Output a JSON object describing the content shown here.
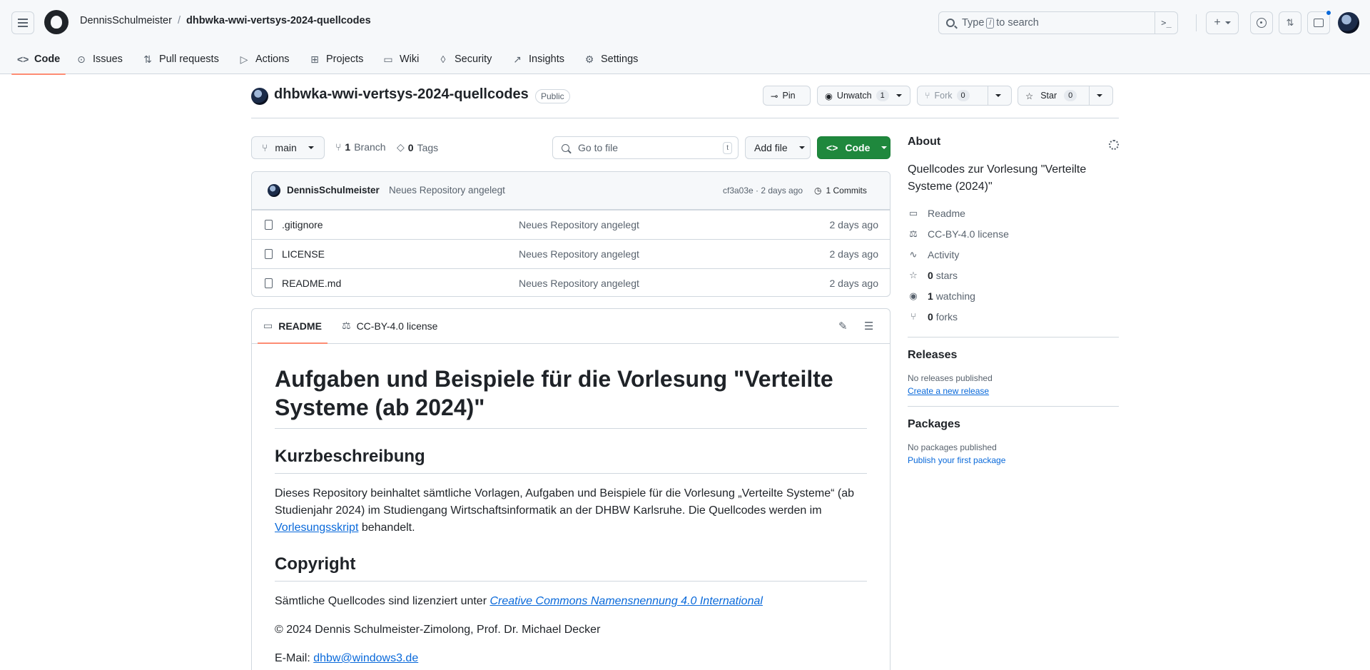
{
  "header": {
    "owner": "DennisSchulmeister",
    "separator": "/",
    "repo": "dhbwka-wwi-vertsys-2024-quellcodes",
    "search_prefix": "Type",
    "search_key": "/",
    "search_suffix": "to search"
  },
  "tabs": [
    {
      "label": "Code",
      "icon": "code-icon"
    },
    {
      "label": "Issues",
      "icon": "issue-icon"
    },
    {
      "label": "Pull requests",
      "icon": "pull-request-icon"
    },
    {
      "label": "Actions",
      "icon": "play-icon"
    },
    {
      "label": "Projects",
      "icon": "table-icon"
    },
    {
      "label": "Wiki",
      "icon": "book-icon"
    },
    {
      "label": "Security",
      "icon": "shield-icon"
    },
    {
      "label": "Insights",
      "icon": "graph-icon"
    },
    {
      "label": "Settings",
      "icon": "gear-icon"
    }
  ],
  "repo": {
    "title": "dhbwka-wwi-vertsys-2024-quellcodes",
    "visibility": "Public",
    "pin_label": "Pin",
    "watch_label": "Unwatch",
    "watch_count": "1",
    "fork_label": "Fork",
    "fork_count": "0",
    "star_label": "Star",
    "star_count": "0"
  },
  "branchbar": {
    "branch": "main",
    "branch_count": "1",
    "branch_label": "Branch",
    "tag_count": "0",
    "tag_label": "Tags",
    "goto_placeholder": "Go to file",
    "goto_key": "t",
    "add_file": "Add file",
    "code": "Code"
  },
  "latest_commit": {
    "author": "DennisSchulmeister",
    "message": "Neues Repository angelegt",
    "hash_time": "cf3a03e · 2 days ago",
    "commits": "1 Commits"
  },
  "files": [
    {
      "name": ".gitignore",
      "message": "Neues Repository angelegt",
      "age": "2 days ago"
    },
    {
      "name": "LICENSE",
      "message": "Neues Repository angelegt",
      "age": "2 days ago"
    },
    {
      "name": "README.md",
      "message": "Neues Repository angelegt",
      "age": "2 days ago"
    }
  ],
  "readme": {
    "tab_readme": "README",
    "tab_license": "CC-BY-4.0 license",
    "h1": "Aufgaben und Beispiele für die Vorlesung \"Verteilte Systeme (ab 2024)\"",
    "h2_desc": "Kurzbeschreibung",
    "desc_text": "Dieses Repository beinhaltet sämtliche Vorlagen, Aufgaben und Beispiele für die Vorlesung „Verteilte Systeme“ (ab Studienjahr 2024) im Studiengang Wirtschaftsinformatik an der DHBW Karlsruhe. Die Quellcodes werden im ",
    "desc_link": "Vorlesungsskript",
    "desc_end": " behandelt.",
    "h2_copy": "Copyright",
    "license_text": "Sämtliche Quellcodes sind lizenziert unter ",
    "license_link": "Creative Commons Namensnennung 4.0 International",
    "copyright": "© 2024 Dennis Schulmeister-Zimolong, Prof. Dr. Michael Decker",
    "email_label": "E-Mail: ",
    "email": "dhbw@windows3.de"
  },
  "about": {
    "title": "About",
    "description": "Quellcodes zur Vorlesung \"Verteilte Systeme (2024)\"",
    "items": [
      {
        "icon": "book-icon",
        "count": "",
        "label": "Readme"
      },
      {
        "icon": "law-icon",
        "count": "",
        "label": "CC-BY-4.0 license"
      },
      {
        "icon": "pulse-icon",
        "count": "",
        "label": "Activity"
      },
      {
        "icon": "star-icon",
        "count": "0",
        "label": "stars"
      },
      {
        "icon": "eye-icon",
        "count": "1",
        "label": "watching"
      },
      {
        "icon": "fork-icon",
        "count": "0",
        "label": "forks"
      }
    ]
  },
  "releases": {
    "title": "Releases",
    "empty": "No releases published",
    "link": "Create a new release"
  },
  "packages": {
    "title": "Packages",
    "empty": "No packages published",
    "link": "Publish your first package"
  },
  "colors": {
    "accent": "#0969da",
    "primary_button": "#1f883d",
    "tab_underline": "#fd8c73"
  }
}
